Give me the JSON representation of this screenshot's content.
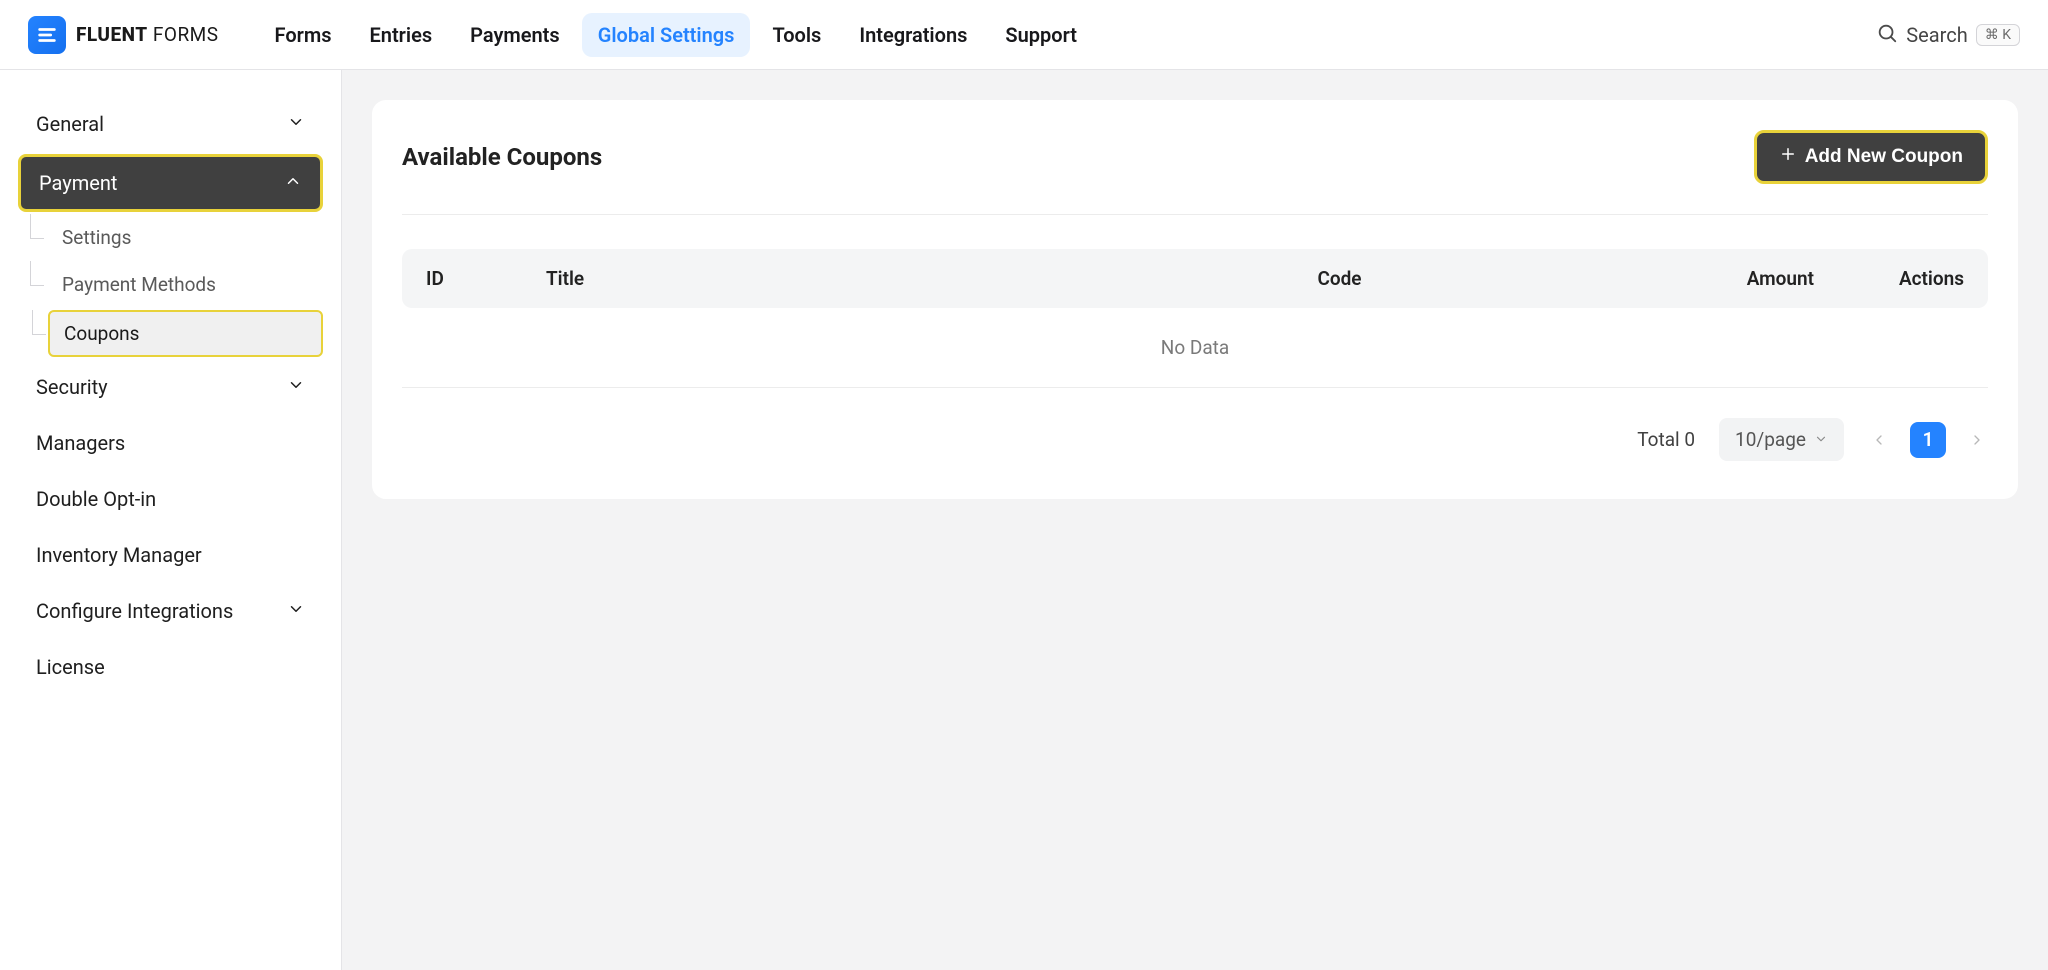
{
  "brand": {
    "bold": "FLUENT",
    "light": " FORMS"
  },
  "topnav": {
    "items": [
      {
        "label": "Forms"
      },
      {
        "label": "Entries"
      },
      {
        "label": "Payments"
      },
      {
        "label": "Global Settings",
        "active": true
      },
      {
        "label": "Tools"
      },
      {
        "label": "Integrations"
      },
      {
        "label": "Support"
      }
    ],
    "search_label": "Search",
    "shortcut": "⌘ K"
  },
  "sidebar": {
    "general": "General",
    "payment": {
      "label": "Payment",
      "settings": "Settings",
      "methods": "Payment Methods",
      "coupons": "Coupons"
    },
    "security": "Security",
    "managers": "Managers",
    "double_optin": "Double Opt-in",
    "inventory": "Inventory Manager",
    "integrations": "Configure Integrations",
    "license": "License"
  },
  "main": {
    "title": "Available Coupons",
    "add_btn": "Add New Coupon",
    "columns": {
      "id": "ID",
      "title": "Title",
      "code": "Code",
      "amount": "Amount",
      "actions": "Actions"
    },
    "empty": "No Data",
    "total_label": "Total 0",
    "page_size": "10/page",
    "current_page": "1"
  }
}
